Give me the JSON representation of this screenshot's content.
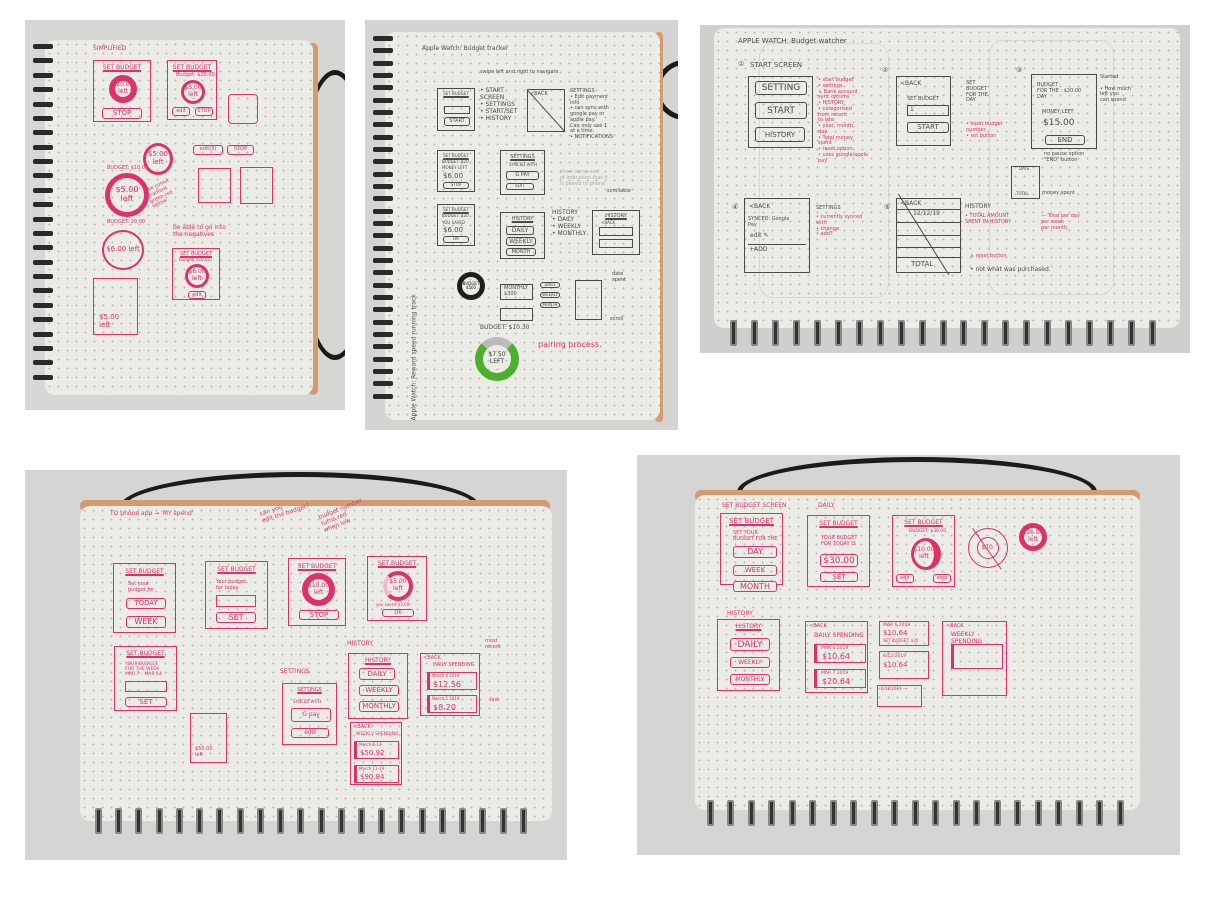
{
  "colors": {
    "pen_pink": "#e0306a",
    "pencil": "#4a4a4a",
    "paper": "#ecece7",
    "ring_green": "#4caf2e"
  },
  "p1": {
    "title": "SIMPLIFIED",
    "b1_title": "SET BUDGET",
    "b1_ring": "$20.00\nleft",
    "b1_btn": "STOP",
    "b2_title": "SET BUDGET",
    "b2_sub": "Budget: $20.00",
    "b2_ring": "$5.00\nleft",
    "b2_edit": "edit",
    "b2_stop": "STOP",
    "ring2": "$5.00\nleft",
    "edit_btn": "edit(3)",
    "stop_btn": "STOP",
    "budget_a": "BUDGET: $10.00",
    "ring3": "$5.00\nleft",
    "gradient_note": "Use colour\ngradient\ngreen-red\nyellow",
    "budget_b": "BUDGET: 20.00",
    "ring4": "$6.00\nleft",
    "neg_note": "be able to go into\nthe negatives",
    "b3_title": "SET BUDGET",
    "b3_sub": "Budget: $20.00",
    "b3_ring": "$6.00\nleft",
    "b3_edit": "edit",
    "b4_text": "$5.00\nleft"
  },
  "p2": {
    "title": "Apple Watch: Budget tracker",
    "swipe": "swipe left and right to navigate",
    "a_title": "SET BUDGET",
    "a_btn": "START",
    "list": "• START\n  SCREEN\n• SETTINGS\n• START/SET\n• HISTORY",
    "b_back": "<BACK",
    "settings_notes": "SETTINGS\n• Edit payment\n  info\n• can sync with\n  google pay or\n  apple pay.\n  Can only use 1\n  at a time.\n• NOTIFICATIONS",
    "c_title": "SET BUDGET",
    "c_budget": "BUDGET: $20",
    "c_money": "MONEY LEFT",
    "c_amount": "$6.00",
    "c_btn": "STOP",
    "d_title": "SETTINGS",
    "d_synced": "SYNCED WITH",
    "d_pay": "G PAY",
    "d_edit": "EDIT",
    "indication": "show some sort\nof indication that it\nis paired to phone",
    "scrollable": "scrollable",
    "e_title": "SET BUDGET",
    "e_budget": "BUDGET: $20",
    "e_saved": "YOU SAVED",
    "e_amount": "$6.00",
    "e_btn": "OK",
    "f_title": "HISTORY",
    "f_daily": "DAILY",
    "f_weekly": "WEEKLY",
    "f_month": "MONTH",
    "history_notes": "HISTORY\n• DAILY\n• WEEKLY\n• MONTHLY",
    "g_title": "HISTORY",
    "g_back": "<BACK",
    "ring_black": "BUDGET\n$500",
    "monthly": "MONTHLY\n$300",
    "mini_daily": "DAILY",
    "mini_weekly": "WEEKLY",
    "mini_month": "MONTH",
    "date_spent": "date\nspent",
    "scroll": "scroll",
    "budget_label": "BUDGET: $10.30",
    "ring_green": "$7.50\nLEFT",
    "pairing": "pairing process.",
    "vertical": "Apple Watch: Reward speed running track"
  },
  "p3": {
    "title": "APPLE WATCH: Budget watcher",
    "n1": "①",
    "start_screen": "START SCREEN",
    "s1_setting": "SETTING",
    "s1_start": "START",
    "s1_history": "HISTORY",
    "notes1": "• start budget\n• settings\n   ↳ Bank account\n     sync options\n• HISTORY\n   • categorised\n     from recent\n     to late\n   • year, month,\n     day\n   • Total money\n     spent\n   • reset option\n• uses google/apple\n  pay",
    "n2": "②",
    "s2_back": "<BACK",
    "s2_label": "SET BUDGET",
    "s2_input": "1",
    "s2_btn": "START",
    "notes2_pencil": "SET\nBUDGET\nFOR THE\nDAY",
    "notes2_pink": "• input budget\n  number\n• set button",
    "n3": "③",
    "s3_budget": "BUDGET\nFOR THE  : $20.00\nDAY",
    "s3_money": "MONEY LEFT",
    "s3_amount": "$15.00",
    "s3_btn": "END",
    "notes3": "Started\n\n• How much\n  left you\n  can spend",
    "no_pause": "no pause option\n\"END\" button",
    "tbl_date": "DATE",
    "tbl_total": "TOTAL",
    "money_spent": "money spent",
    "n4": "④",
    "s4_back": "<BACK",
    "s4_synced": "SYNCED: Google\n               Pay",
    "s4_edit": "edit ✎",
    "s4_add": "+ADD",
    "settings_head": "SETTINGS",
    "notes4": "• currently synced\n  with\n• change\n• add?",
    "n5": "⑤",
    "s5_back": "<BACK",
    "s5_date": "12/12/19",
    "s5_total": "TOTAL",
    "history_head": "HISTORY",
    "notes5": "• TOTAL AMOUNT\n  SPENT IN HISTORY",
    "per": "— Total per day\n    per week\n    per month",
    "reset": "↳ reset button",
    "not_what": "• not what was purchased."
  },
  "p4": {
    "title": "TO phone app → 'MY spend'",
    "edit_q": "can you\nedit the budget?",
    "red_note": "budget number\nturns red\nwhen low",
    "b1_title": "SET BUDGET",
    "b1_text": "Set your\nbudget for",
    "b1_today": "TODAY",
    "b1_week": "WEEK",
    "b2_title": "SET BUDGET",
    "b2_text": "Your budget\nfor today",
    "b2_btn": "SET",
    "b3_title": "SET BUDGET",
    "b3_ring": "$10.00\nleft",
    "b3_btn": "STOP",
    "b4_title": "SET BUDGET",
    "b4_ring": "$5.00\nleft",
    "b4_saved": "you saved $5.00!",
    "b4_btn": "OK",
    "b5_title": "SET BUDGET",
    "b5_text": "YOUR BUDGET\nFOR THE WEEK\nMAR 7 – MAR 14",
    "b5_btn": "SET",
    "doc_text": "$50.00\nleft",
    "settings_head": "SETTINGS",
    "st_title": "SETTINGS",
    "st_synced": "SYNCED WITH",
    "st_pay": "G pay",
    "st_edit": "edit",
    "history_head": "HISTORY",
    "h_title": "HISTORY",
    "h_daily": "DAILY",
    "h_weekly": "WEEKLY",
    "h_monthly": "MONTHLY",
    "d_back": "<BACK",
    "d_title": "DAILY SPENDING",
    "d_date1": "March 6 2019",
    "d_amt1": "$12.56",
    "d_date2": "March 5 2019",
    "d_amt2": "$8.20",
    "most_recent": "most\nrecent",
    "last": "last",
    "w_back": "<BACK",
    "w_title": "WEEKLY SPENDING",
    "w_date1": "March 6-12",
    "w_amt1": "$50.92",
    "w_date2": "March 13-19",
    "w_amt2": "$90.84"
  },
  "p5": {
    "screen_head": "SET BUDGET SCREEN",
    "daily_head": "DAILY",
    "b1_title": "SET BUDGET",
    "b1_text": "SET YOUR\nBUDGET FOR THE",
    "b1_day": "DAY",
    "b1_week": "WEEK",
    "b1_month": "MONTH",
    "b2_title": "SET BUDGET",
    "b2_text": "YOUR BUDGET\nFOR TODAY IS",
    "b2_amount": "$30.00",
    "b2_btn": "SET",
    "b3_title": "SET BUDGET",
    "b3_budget": "BUDGET: $30.00",
    "b3_ring": "$10.00\nleft",
    "b3_edit": "edit",
    "b3_stop": "stop",
    "crossed": "$10.",
    "ring_small": "$26.00\nleft",
    "history_head": "HISTORY",
    "h_title": "HISTORY",
    "h_daily": "DAILY",
    "h_weekly": "WEEKLY",
    "h_monthly": "MONTHLY",
    "d_back": "<BACK",
    "d_title": "DAILY SPENDING",
    "d_date1": "MAR 6 2019",
    "d_amt1": "$10.64",
    "d_date2": "MAR 7 2019",
    "d_amt2": "$20.64",
    "c1_date": "MAR 6 2019",
    "c1_amt": "$10.64",
    "c1_set": "SET BUDGET: $20",
    "c2_date": "6/12/2019",
    "c2_amt": "$10.64",
    "c3_date": "6/12/2019 —",
    "w_back": "<BACK",
    "w_title": "WEEKLY SPENDING"
  }
}
